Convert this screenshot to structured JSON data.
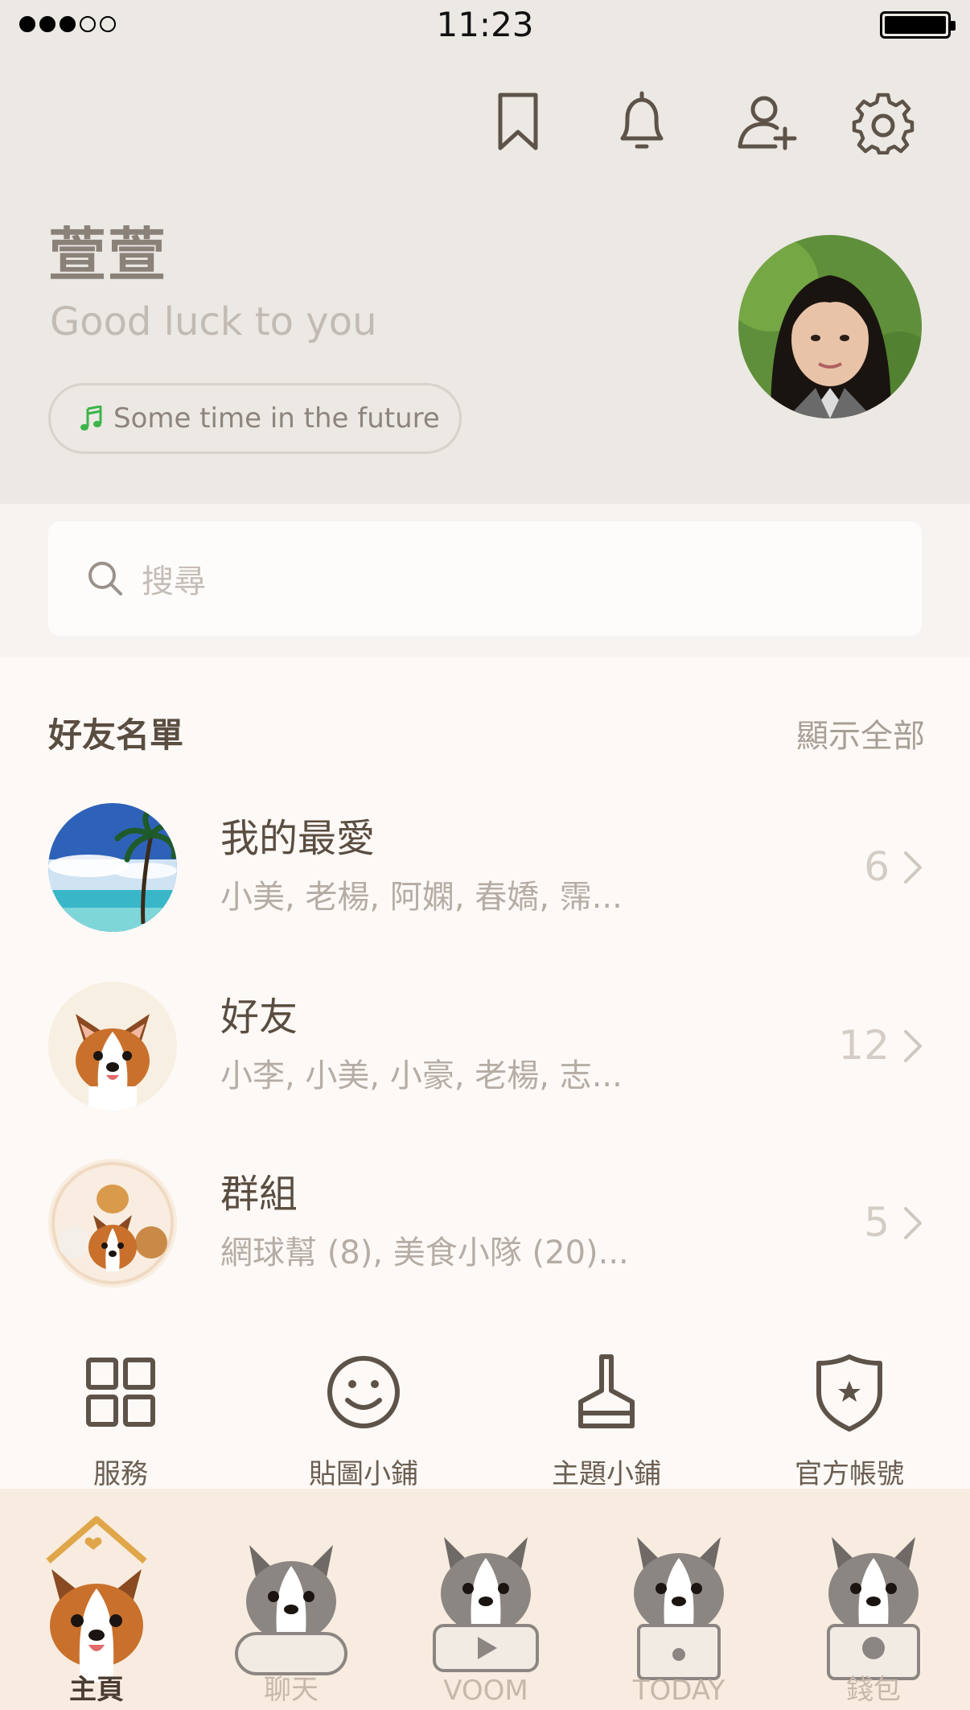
{
  "status_bar": {
    "time": "11:23"
  },
  "header": {
    "icons": [
      "bookmark-icon",
      "bell-icon",
      "add-friend-icon",
      "gear-icon"
    ]
  },
  "profile": {
    "name": "萱萱",
    "status_message": "Good luck to you",
    "music": "Some time in the future"
  },
  "search": {
    "placeholder": "搜尋"
  },
  "friends": {
    "section_title": "好友名單",
    "show_all": "顯示全部",
    "items": [
      {
        "title": "我的最愛",
        "subtitle": "小美, 老楊, 阿嫻, 春嬌, 霈...",
        "count": "6"
      },
      {
        "title": "好友",
        "subtitle": "小李, 小美, 小豪, 老楊, 志...",
        "count": "12"
      },
      {
        "title": "群組",
        "subtitle": "網球幫 (8), 美食小隊 (20)...",
        "count": "5"
      }
    ]
  },
  "services": [
    {
      "label": "服務",
      "icon": "grid-icon"
    },
    {
      "label": "貼圖小鋪",
      "icon": "smiley-icon"
    },
    {
      "label": "主題小鋪",
      "icon": "brush-icon"
    },
    {
      "label": "官方帳號",
      "icon": "shield-star-icon"
    }
  ],
  "tabs": [
    {
      "label": "主頁",
      "active": true
    },
    {
      "label": "聊天",
      "active": false
    },
    {
      "label": "VOOM",
      "active": false
    },
    {
      "label": "TODAY",
      "active": false
    },
    {
      "label": "錢包",
      "active": false
    }
  ],
  "colors": {
    "header_bg": "#ece8e4",
    "page_bg": "#fdf9f6",
    "text_primary": "#5a4d41",
    "text_muted": "#b5ada5",
    "music_note": "#3bb54a",
    "tabbar_bg": "#f8ece0"
  }
}
